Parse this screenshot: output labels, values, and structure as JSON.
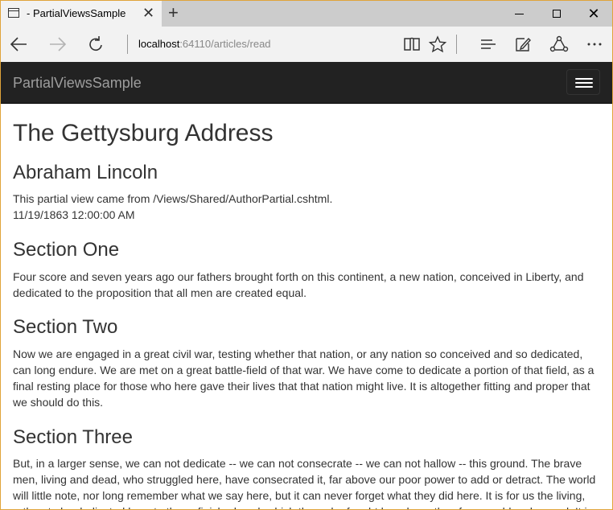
{
  "browser": {
    "tab_title": "- PartialViewsSample",
    "tab_close": "✕",
    "new_tab": "+",
    "close_window": "✕",
    "url_host": "localhost",
    "url_rest": ":64110/articles/read",
    "icons": {
      "back": "arrow-left-icon",
      "forward": "arrow-right-icon",
      "refresh": "refresh-icon",
      "reading_view": "book-icon",
      "favorite": "star-icon",
      "hub": "hub-icon",
      "notes": "pen-note-icon",
      "share": "share-icon",
      "more": "more-icon"
    }
  },
  "site": {
    "brand": "PartialViewsSample"
  },
  "article": {
    "title": "The Gettysburg Address",
    "author": "Abraham Lincoln",
    "partial_note": "This partial view came from /Views/Shared/AuthorPartial.cshtml.",
    "date": "11/19/1863 12:00:00 AM",
    "sections": [
      {
        "heading": "Section One",
        "text": "Four score and seven years ago our fathers brought forth on this continent, a new nation, conceived in Liberty, and dedicated to the proposition that all men are created equal."
      },
      {
        "heading": "Section Two",
        "text": "Now we are engaged in a great civil war, testing whether that nation, or any nation so conceived and so dedicated, can long endure. We are met on a great battle-field of that war. We have come to dedicate a portion of that field, as a final resting place for those who here gave their lives that that nation might live. It is altogether fitting and proper that we should do this."
      },
      {
        "heading": "Section Three",
        "text": "But, in a larger sense, we can not dedicate -- we can not consecrate -- we can not hallow -- this ground. The brave men, living and dead, who struggled here, have consecrated it, far above our poor power to add or detract. The world will little note, nor long remember what we say here, but it can never forget what they did here. It is for us the living, rather, to be dedicated here to the unfinished work which they who fought here have thus far so nobly advanced. It is"
      }
    ]
  }
}
